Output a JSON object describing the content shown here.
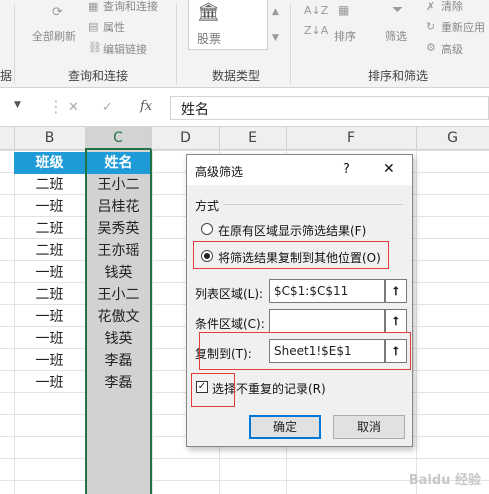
{
  "ribbon": {
    "partial_left": "据",
    "refresh_all": "全部刷新",
    "query_connect_btn": "查询和连接",
    "properties": "属性",
    "edit_links": "编辑链接",
    "group_query": "查询和连接",
    "stock": "股票",
    "group_datatype": "数据类型",
    "sort": "排序",
    "filter": "筛选",
    "clear": "清除",
    "reapply": "重新应用",
    "advanced": "高级",
    "group_sortfilter": "排序和筛选"
  },
  "formula": {
    "cancel": "✕",
    "enter": "✓",
    "fx": "fx",
    "content": "姓名"
  },
  "columns": [
    "B",
    "C",
    "D",
    "E",
    "F",
    "G"
  ],
  "table": {
    "header": [
      "班级",
      "姓名"
    ],
    "rows": [
      [
        "二班",
        "王小二"
      ],
      [
        "一班",
        "吕桂花"
      ],
      [
        "二班",
        "吴秀英"
      ],
      [
        "二班",
        "王亦瑶"
      ],
      [
        "一班",
        "钱英"
      ],
      [
        "二班",
        "王小二"
      ],
      [
        "一班",
        "花傲文"
      ],
      [
        "一班",
        "钱英"
      ],
      [
        "一班",
        "李磊"
      ],
      [
        "一班",
        "李磊"
      ]
    ]
  },
  "dialog": {
    "title": "高级筛选",
    "help": "?",
    "close": "✕",
    "section": "方式",
    "option_inplace": "在原有区域显示筛选结果(F)",
    "option_copy": "将筛选结果复制到其他位置(O)",
    "list_range_label": "列表区域(L):",
    "list_range_value": "$C$1:$C$11",
    "criteria_label": "条件区域(C):",
    "criteria_value": "",
    "copy_to_label": "复制到(T):",
    "copy_to_value": "Sheet1!$E$1",
    "unique_label": "选择不重复的记录(R)",
    "unique_checked": true,
    "ok": "确定",
    "cancel": "取消"
  },
  "watermark": "Baidu 经验"
}
